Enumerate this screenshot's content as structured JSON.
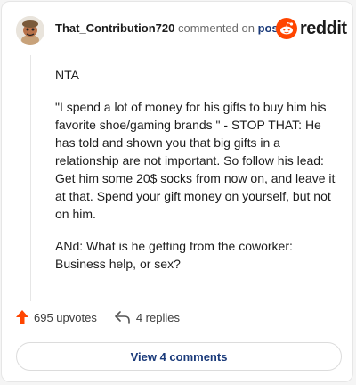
{
  "header": {
    "username": "That_Contribution720",
    "commented_text": "commented on",
    "post_link": "post",
    "logo_text": "reddit"
  },
  "comment": {
    "paragraphs": [
      "NTA",
      "\"I spend a lot of money for his gifts to buy him his favorite shoe/gaming brands \" - STOP THAT: He has told and shown you that big gifts in a relationship are not important. So follow his lead: Get him some 20$ socks from now on, and leave it at that. Spend your gift money on yourself, but not on him.",
      "ANd: What is he getting from the coworker: Business help, or sex?"
    ]
  },
  "footer": {
    "upvotes": "695 upvotes",
    "replies": "4 replies",
    "view_button": "View 4 comments"
  },
  "colors": {
    "upvote": "#ff4500",
    "link": "#1a3a7a",
    "reddit_orange": "#ff4500"
  }
}
